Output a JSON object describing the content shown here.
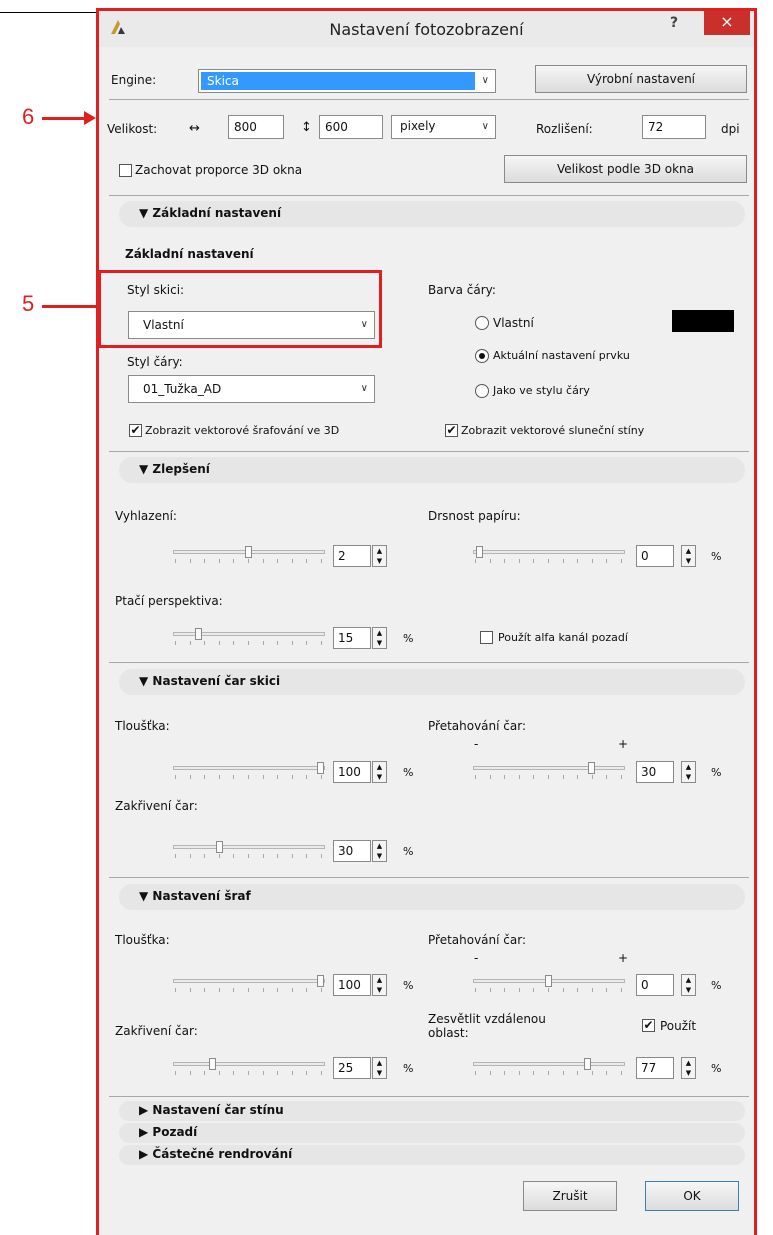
{
  "window": {
    "title": "Nastavení fotozobrazení",
    "help": "?",
    "close": "×"
  },
  "annotations": {
    "six": "6",
    "five": "5"
  },
  "engine": {
    "label": "Engine:",
    "value": "Skica",
    "defaults_button": "Výrobní nastavení"
  },
  "size": {
    "label": "Velikost:",
    "width": "800",
    "height": "600",
    "unit": "pixely",
    "resolution_label": "Rozlišení:",
    "resolution": "72",
    "resolution_unit": "dpi",
    "keep_ratio": "Zachovat proporce 3D okna",
    "fit_button": "Velikost podle 3D okna"
  },
  "basic": {
    "section": "Základní nastavení",
    "heading": "Základní nastavení",
    "sketch_style_label": "Styl skici:",
    "sketch_style": "Vlastní",
    "line_style_label": "Styl čáry:",
    "line_style": "01_Tužka_AD",
    "line_color_label": "Barva čáry:",
    "color_custom": "Vlastní",
    "color_current": "Aktuální nastavení prvku",
    "color_line": "Jako ve stylu čáry",
    "show_vector_hatch": "Zobrazit vektorové šrafování ve 3D",
    "show_vector_shadows": "Zobrazit vektorové sluneční stíny",
    "swatch_color": "#000000"
  },
  "improve": {
    "section": "Zlepšení",
    "smoothing_label": "Vyhlazení:",
    "smoothing": "2",
    "smoothing_level": 0.5,
    "paper_label": "Drsnost papíru:",
    "paper": "0",
    "paper_level": 0.02,
    "paper_unit": "%",
    "birdseye_label": "Ptačí perspektiva:",
    "birdseye": "15",
    "birdseye_level": 0.15,
    "birdseye_unit": "%",
    "alpha": "Použít alfa kanál pozadí"
  },
  "sketchlines": {
    "section": "Nastavení čar skici",
    "thickness_label": "Tloušťka:",
    "thickness": "100",
    "thickness_level": 1.0,
    "thickness_unit": "%",
    "overdraw_label": "Přetahování čar:",
    "minus": "-",
    "plus": "+",
    "overdraw": "30",
    "overdraw_level": 0.8,
    "overdraw_unit": "%",
    "curv_label": "Zakřivení čar:",
    "curv": "30",
    "curv_level": 0.3,
    "curv_unit": "%"
  },
  "hatch": {
    "section": "Nastavení šraf",
    "thickness_label": "Tloušťka:",
    "thickness": "100",
    "thickness_level": 1.0,
    "thickness_unit": "%",
    "overdraw_label": "Přetahování čar:",
    "minus": "-",
    "plus": "+",
    "overdraw": "0",
    "overdraw_level": 0.5,
    "overdraw_unit": "%",
    "curv_label": "Zakřivení čar:",
    "curv": "25",
    "curv_level": 0.25,
    "curv_unit": "%",
    "fade_label": "Zesvětlit vzdálenou oblast:",
    "fade_use": "Použít",
    "fade": "77",
    "fade_level": 0.77,
    "fade_unit": "%"
  },
  "collapsed": {
    "shadow": "Nastavení čar stínu",
    "background": "Pozadí",
    "partial": "Částečné rendrování"
  },
  "footer": {
    "cancel": "Zrušit",
    "ok": "OK"
  }
}
